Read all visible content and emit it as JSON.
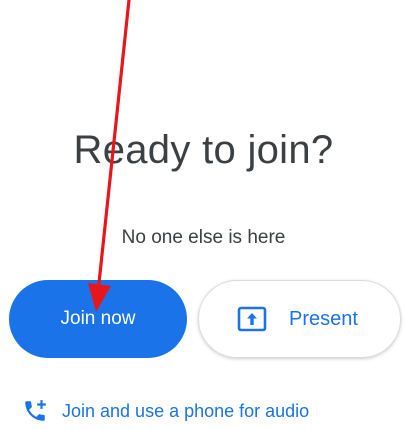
{
  "prejoin": {
    "title": "Ready to join?",
    "subtitle": "No one else is here",
    "join_button_label": "Join now",
    "present_button_label": "Present",
    "phone_audio_label": "Join and use a phone for audio"
  },
  "icons": {
    "present": "present-to-all-icon",
    "phone": "phone-add-icon"
  },
  "colors": {
    "accent": "#1a73e8",
    "text": "#3c4043",
    "annotation_arrow": "#e8161b"
  }
}
